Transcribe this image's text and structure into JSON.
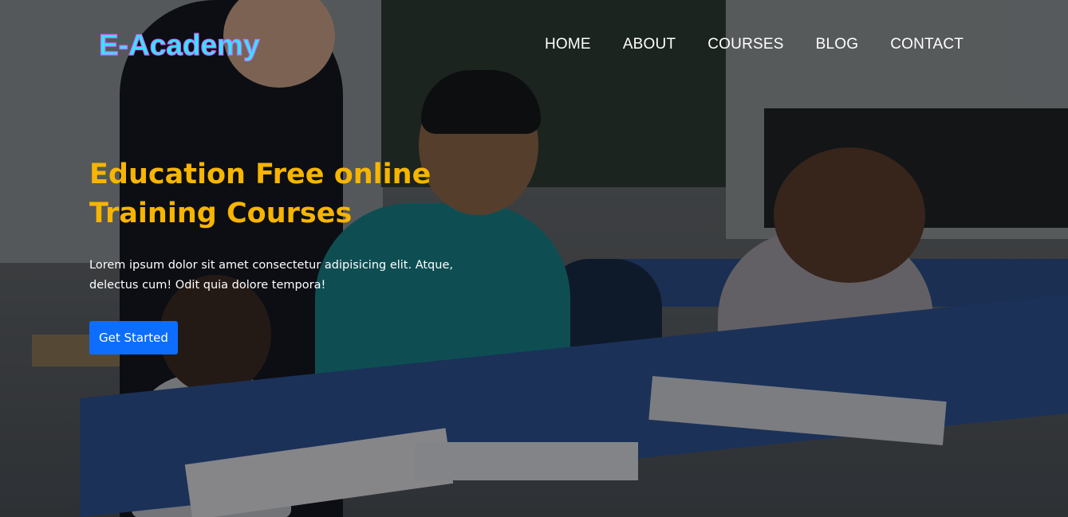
{
  "brand": {
    "name": "E-Academy",
    "color": "#31e6ff",
    "outline_color": "#c36cff"
  },
  "nav": {
    "items": [
      {
        "label": "HOME"
      },
      {
        "label": "ABOUT"
      },
      {
        "label": "COURSES"
      },
      {
        "label": "BLOG"
      },
      {
        "label": "CONTACT"
      }
    ],
    "color": "#ffffff"
  },
  "hero": {
    "title": "Education Free online Training Courses",
    "title_color": "#f7b500",
    "text": "Lorem ipsum dolor sit amet consectetur adipisicing elit. Atque, delectus cum! Odit quia dolore tempora!",
    "text_color": "#ffffff",
    "cta_label": "Get Started",
    "cta_bg": "#0d6efd",
    "cta_color": "#ffffff"
  }
}
